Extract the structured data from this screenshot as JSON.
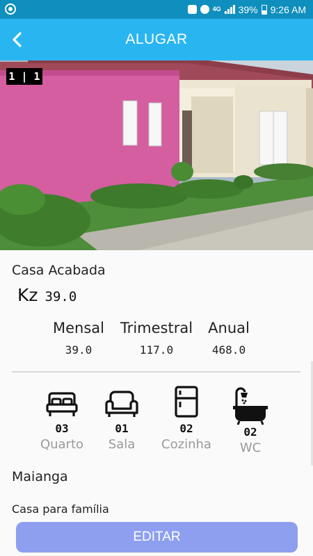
{
  "status_bar": {
    "network": "4G",
    "battery": "39%",
    "time": "9:26 AM"
  },
  "app_bar": {
    "title": "ALUGAR",
    "back_icon": "chevron-left-icon"
  },
  "gallery": {
    "counter": "1 | 1"
  },
  "property": {
    "title": "Casa Acabada",
    "currency": "Kz",
    "price": "39.0",
    "periods": [
      {
        "label": "Mensal",
        "value": "39.0"
      },
      {
        "label": "Trimestral",
        "value": "117.0"
      },
      {
        "label": "Anual",
        "value": "468.0"
      }
    ],
    "amenities": [
      {
        "icon": "bed-icon",
        "count": "03",
        "label": "Quarto"
      },
      {
        "icon": "sofa-icon",
        "count": "01",
        "label": "Sala"
      },
      {
        "icon": "fridge-icon",
        "count": "02",
        "label": "Cozinha"
      },
      {
        "icon": "bathtub-icon",
        "count": "02",
        "label": "WC"
      }
    ],
    "location": "Maianga",
    "description": "Casa para família"
  },
  "actions": {
    "edit_label": "EDITAR"
  },
  "colors": {
    "status_bar": "#0f8fbd",
    "app_bar": "#29b6f0",
    "edit_button": "#8e9ff0",
    "label_gray": "#9a9a9a"
  }
}
